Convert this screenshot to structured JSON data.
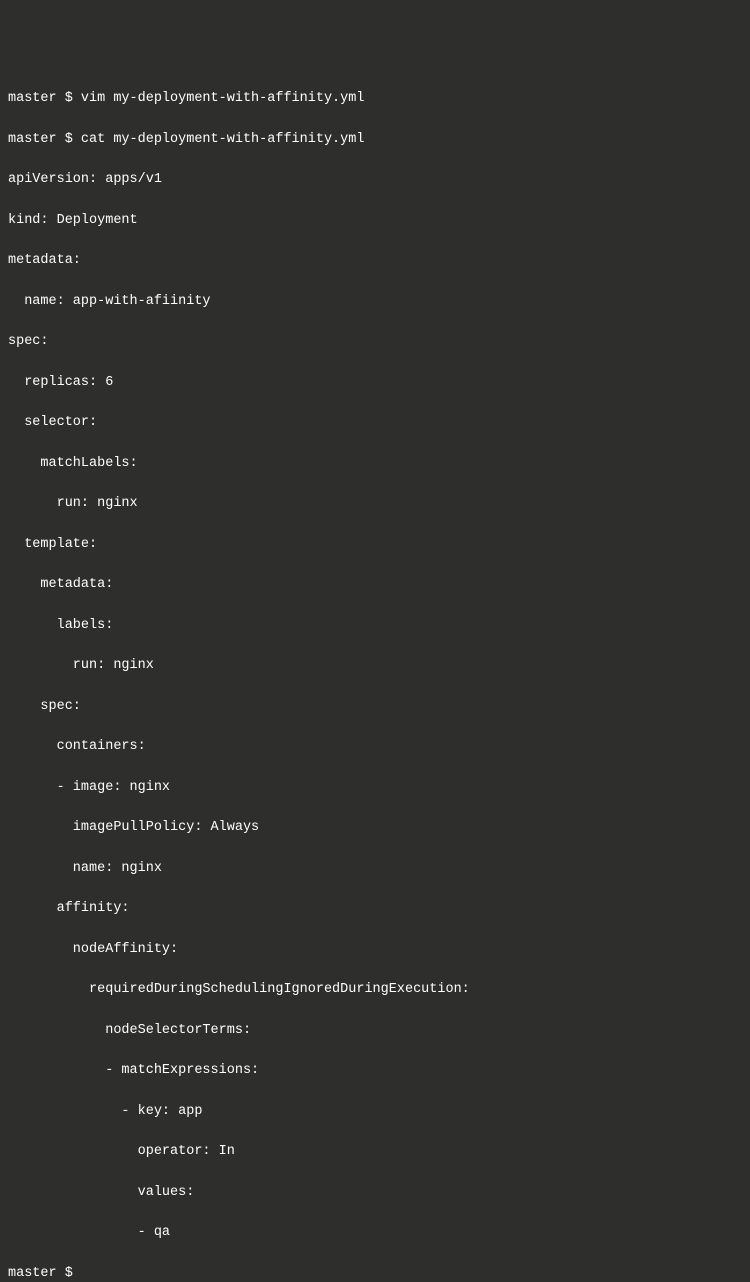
{
  "lines": [
    "master $ vim my-deployment-with-affinity.yml",
    "master $ cat my-deployment-with-affinity.yml",
    "apiVersion: apps/v1",
    "kind: Deployment",
    "metadata:",
    "  name: app-with-afiinity",
    "spec:",
    "  replicas: 6",
    "  selector:",
    "    matchLabels:",
    "      run: nginx",
    "  template:",
    "    metadata:",
    "      labels:",
    "        run: nginx",
    "    spec:",
    "      containers:",
    "      - image: nginx",
    "        imagePullPolicy: Always",
    "        name: nginx",
    "      affinity:",
    "        nodeAffinity:",
    "          requiredDuringSchedulingIgnoredDuringExecution:",
    "            nodeSelectorTerms:",
    "            - matchExpressions:",
    "              - key: app",
    "                operator: In",
    "                values:",
    "                - qa",
    "master $"
  ]
}
